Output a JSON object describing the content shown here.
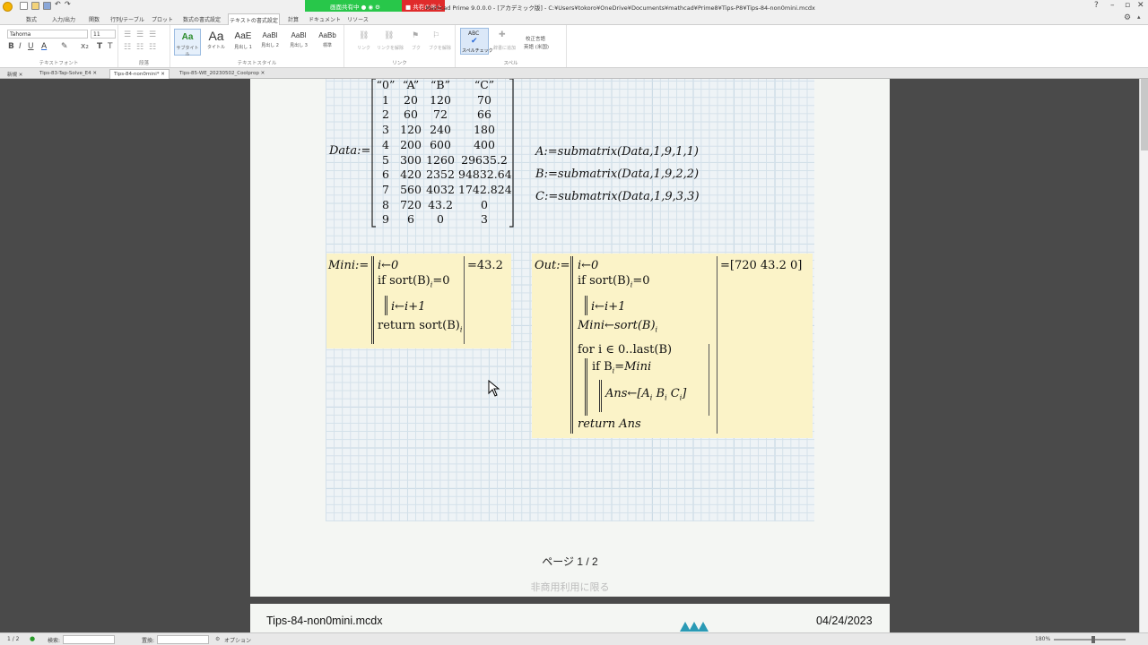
{
  "titlebar": {
    "title": "- Mathcad Prime 9.0.0.0 - [アカデミック版] - C:¥Users¥tokoro¥OneDrive¥Documents¥mathcad¥Prime8¥Tips-P8¥Tips-84-non0mini.mcdx",
    "share_label": "画面共有中",
    "stop_label": "共有の停止"
  },
  "ribbon_tabs": [
    "数式",
    "入力/出力",
    "関数",
    "行列/テーブル",
    "プロット",
    "数式の書式設定",
    "テキストの書式設定",
    "計算",
    "ドキュメント",
    "リソース"
  ],
  "ribbon": {
    "font_name": "Tahoma",
    "font_size": "11",
    "styles": [
      {
        "sample": "Aa",
        "label": "サブタイトル"
      },
      {
        "sample": "Aa",
        "label": "タイトル"
      },
      {
        "sample": "AaE",
        "label": "見出し 1"
      },
      {
        "sample": "AaBl",
        "label": "見出し 2"
      },
      {
        "sample": "AaBl",
        "label": "見出し 3"
      },
      {
        "sample": "AaBb",
        "label": "標準"
      }
    ],
    "link_items": [
      "リンク",
      "リンクを解除",
      "ブク",
      "ブクを解除"
    ],
    "spell_label": "スペルチェック",
    "abc": "ABC",
    "add_dict": "辞書に追加",
    "proof_lang_label": "校正言語",
    "proof_lang": "英語 (米国)",
    "groups": [
      "テキストフォント",
      "段落",
      "テキストスタイル",
      "リンク",
      "スペル"
    ]
  },
  "doc_tabs": [
    "新規",
    "Tips-83-Tap-Solve_E4",
    "Tips-84-non0mini*",
    "Tips-85-WE_20230502_Coolprop"
  ],
  "worksheet": {
    "data_def": "Data:=",
    "matrix": [
      [
        "“0”",
        "“A”",
        "“B”",
        "“C”"
      ],
      [
        "1",
        "20",
        "120",
        "70"
      ],
      [
        "2",
        "60",
        "72",
        "66"
      ],
      [
        "3",
        "120",
        "240",
        "180"
      ],
      [
        "4",
        "200",
        "600",
        "400"
      ],
      [
        "5",
        "300",
        "1260",
        "29635.2"
      ],
      [
        "6",
        "420",
        "2352",
        "94832.64"
      ],
      [
        "7",
        "560",
        "4032",
        "1742.824"
      ],
      [
        "8",
        "720",
        "43.2",
        "0"
      ],
      [
        "9",
        "6",
        "0",
        "3"
      ]
    ],
    "submatrix_defs": [
      {
        "lhs": "A",
        "rhs": "submatrix(Data,1,9,1,1)"
      },
      {
        "lhs": "B",
        "rhs": "submatrix(Data,1,9,2,2)"
      },
      {
        "lhs": "C",
        "rhs": "submatrix(Data,1,9,3,3)"
      }
    ],
    "mini": {
      "def": "Mini:=",
      "line1": "i←0",
      "line2": "if sort(B)",
      "line2b": "=0",
      "sub_i": "i",
      "line3": "i←i+1",
      "line4": "return sort(B)",
      "result": "=43.2"
    },
    "out": {
      "def": "Out:=",
      "line1": "i←0",
      "line2": "if sort(B)",
      "line2b": "=0",
      "sub_i": "i",
      "line3": "i←i+1",
      "line4": "Mini←sort(B)",
      "line5": "for i ∈ 0..last(B)",
      "line6a": "if B",
      "line6b": "=Mini",
      "line7a": "Ans←[A",
      "line7b": "B",
      "line7c": "C",
      "line7d": "]",
      "line8": "return Ans",
      "result": "=[720  43.2  0]"
    }
  },
  "page": {
    "number": "ページ 1 / 2",
    "noncommercial": "非商用利用に限る",
    "footer_file": "Tips-84-non0mini.mcdx",
    "footer_date": "04/24/2023"
  },
  "status": {
    "page": "1 / 2",
    "search_label": "検索:",
    "replace_label": "置換:",
    "options_label": "オプション",
    "zoom": "180%"
  }
}
